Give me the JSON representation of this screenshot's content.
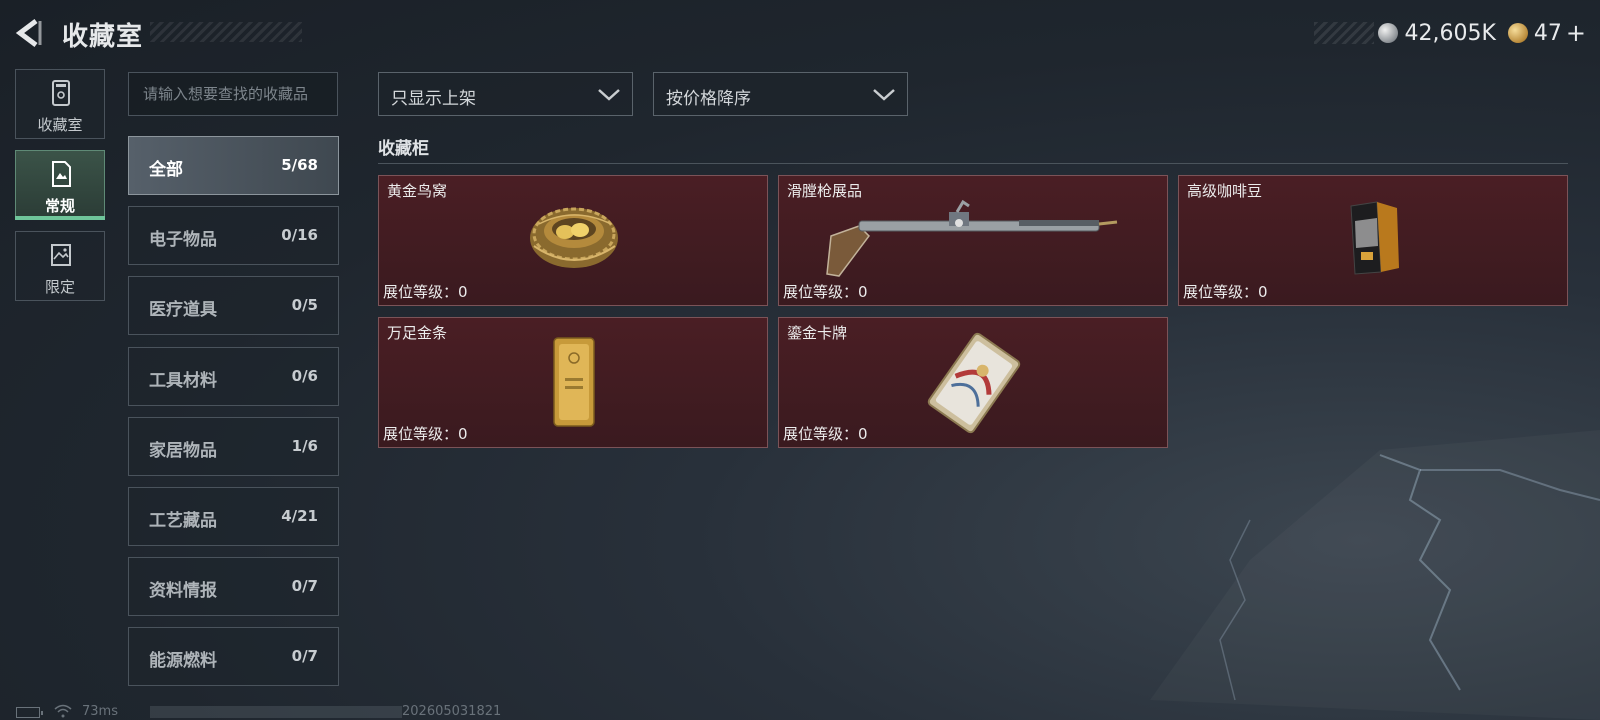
{
  "header": {
    "back_label": "",
    "title": "收藏室",
    "currency_silver": "42,605K",
    "currency_gold": "47",
    "plus": "+"
  },
  "nav": {
    "items": [
      {
        "label": "收藏室",
        "icon": "cabinet-icon"
      },
      {
        "label": "常规",
        "icon": "document-icon",
        "active": true
      },
      {
        "label": "限定",
        "icon": "image-icon"
      }
    ]
  },
  "search": {
    "placeholder": "请输入想要查找的收藏品"
  },
  "categories": [
    {
      "name": "全部",
      "count": "5/68",
      "active": true
    },
    {
      "name": "电子物品",
      "count": "0/16"
    },
    {
      "name": "医疗道具",
      "count": "0/5"
    },
    {
      "name": "工具材料",
      "count": "0/6"
    },
    {
      "name": "家居物品",
      "count": "1/6"
    },
    {
      "name": "工艺藏品",
      "count": "4/21"
    },
    {
      "name": "资料情报",
      "count": "0/7"
    },
    {
      "name": "能源燃料",
      "count": "0/7"
    }
  ],
  "filters": {
    "shelf_filter": "只显示上架",
    "sort": "按价格降序"
  },
  "cabinet": {
    "title": "收藏柜",
    "items": [
      {
        "name": "黄金鸟窝",
        "level": "展位等级：0",
        "icon": "golden-nest-icon"
      },
      {
        "name": "滑膛枪展品",
        "level": "展位等级：0",
        "icon": "musket-icon"
      },
      {
        "name": "高级咖啡豆",
        "level": "展位等级：0",
        "icon": "coffee-bag-icon"
      },
      {
        "name": "万足金条",
        "level": "展位等级：0",
        "icon": "gold-bar-icon"
      },
      {
        "name": "鎏金卡牌",
        "level": "展位等级：0",
        "icon": "gilded-card-icon"
      }
    ]
  },
  "footer": {
    "ping": "73ms",
    "build": "202605031821"
  },
  "colors": {
    "accent_green": "#6fc59a",
    "card_bg": "#4a1e24",
    "card_border": "#7b5358"
  }
}
